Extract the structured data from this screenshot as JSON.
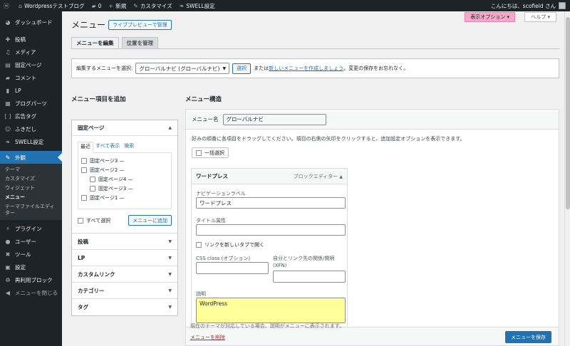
{
  "adminbar": {
    "site_name": "Wordpressテストブログ",
    "comments_count": "0",
    "new_label": "新規",
    "customize_label": "カスタマイズ",
    "swell_label": "SWELL設定",
    "greeting": "こんにちは、scofield さん"
  },
  "sidebar": {
    "items": [
      {
        "label": "ダッシュボード",
        "icon": "dashboard-icon"
      },
      {
        "label": "投稿",
        "icon": "pin-icon"
      },
      {
        "label": "メディア",
        "icon": "media-icon"
      },
      {
        "label": "固定ページ",
        "icon": "page-icon"
      },
      {
        "label": "コメント",
        "icon": "comment-icon"
      },
      {
        "label": "LP",
        "icon": "lp-icon"
      },
      {
        "label": "ブログパーツ",
        "icon": "parts-icon"
      },
      {
        "label": "広告タグ",
        "icon": "ad-icon"
      },
      {
        "label": "ふきだし",
        "icon": "bubble-icon"
      },
      {
        "label": "SWELL設定",
        "icon": "swell-icon"
      }
    ],
    "active": {
      "label": "外観",
      "icon": "brush-icon"
    },
    "submenu": [
      "テーマ",
      "カスタマイズ",
      "ウィジェット",
      "メニュー",
      "テーマファイルエディター"
    ],
    "items_after": [
      {
        "label": "プラグイン",
        "icon": "plugin-icon"
      },
      {
        "label": "ユーザー",
        "icon": "user-icon"
      },
      {
        "label": "ツール",
        "icon": "tool-icon"
      },
      {
        "label": "設定",
        "icon": "settings-icon"
      },
      {
        "label": "再利用ブロック",
        "icon": "reuse-icon"
      },
      {
        "label": "メニューを閉じる",
        "icon": "collapse-icon"
      }
    ]
  },
  "header": {
    "screen_options": "表示オプション ▾",
    "help": "ヘルプ ▾",
    "title": "メニュー",
    "live_preview": "ライブプレビューで管理",
    "tabs": [
      "メニューを編集",
      "位置を管理"
    ]
  },
  "select_bar": {
    "label": "編集するメニューを選択:",
    "selected": "グローバルナビ (グローバルナビ)",
    "select_button": "選択",
    "or_text": "または",
    "create_link": "新しいメニューを作成しましょう",
    "suffix": "。変更の保存をお忘れなく。"
  },
  "add_items": {
    "heading": "メニュー項目を追加",
    "open_section": "固定ページ",
    "inner_tabs": [
      "最近",
      "すべて表示",
      "検索"
    ],
    "pages": [
      {
        "label": "固定ページ3 —",
        "indent": false
      },
      {
        "label": "固定ページ2 —",
        "indent": false
      },
      {
        "label": "固定ページ4 —",
        "indent": true
      },
      {
        "label": "固定ページ3 —",
        "indent": true
      },
      {
        "label": "固定ページ1 —",
        "indent": false
      }
    ],
    "select_all": "すべて選択",
    "add_button": "メニューに追加",
    "sections": [
      "投稿",
      "LP",
      "カスタムリンク",
      "カテゴリー",
      "タグ"
    ]
  },
  "structure": {
    "heading": "メニュー構造",
    "name_label": "メニュー名",
    "name_value": "グローバルナビ",
    "instructions": "好みの順番に各項目をドラッグしてください。項目の右側の矢印をクリックすると、追加設定オプションを表示できます。",
    "bulk_select": "一括選択",
    "item": {
      "title": "ワードプレス",
      "type": "ブロックエディター",
      "nav_label_caption": "ナビゲーションラベル",
      "nav_label_value": "ワードプレス",
      "title_attr_caption": "タイトル属性",
      "new_tab_caption": "リンクを新しいタブで開く",
      "css_caption": "CSS class (オプション)",
      "xfn_caption": "自分とリンク先の関係/関柄 (XFN)",
      "desc_caption": "説明",
      "desc_value": "WordPress",
      "cut_text": "現在のテーマが対応している場合、説明がメニューに表示されます。"
    },
    "delete_link": "メニューを削除",
    "save_button": "メニューを保存"
  }
}
